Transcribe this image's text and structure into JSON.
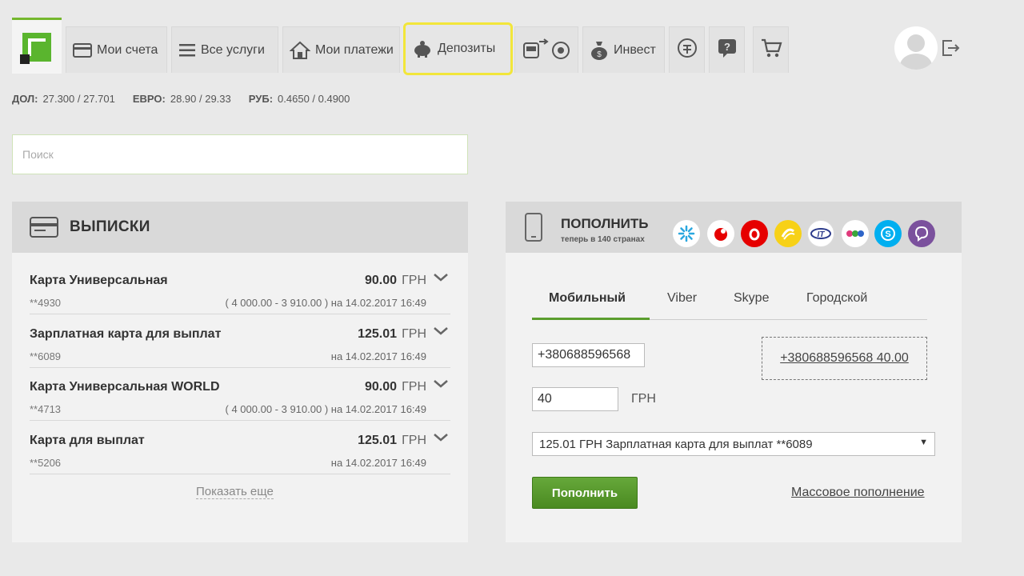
{
  "nav": {
    "tabs": [
      {
        "label": "Мои счета",
        "icon": "card-icon"
      },
      {
        "label": "Все услуги",
        "icon": "list-icon"
      },
      {
        "label": "Мои платежи",
        "icon": "home-icon"
      },
      {
        "label": "Депозиты",
        "icon": "piggy-bank-icon"
      },
      {
        "label": "",
        "icon": "transport-icon"
      },
      {
        "label": "Инвест",
        "icon": "money-bag-icon"
      },
      {
        "label": "",
        "icon": "currency-icon"
      },
      {
        "label": "",
        "icon": "help-icon"
      },
      {
        "label": "",
        "icon": "cart-icon"
      }
    ],
    "highlight_color": "#f2e63a"
  },
  "rates": [
    {
      "label": "ДОЛ:",
      "value": "27.300 / 27.701"
    },
    {
      "label": "ЕВРО:",
      "value": "28.90 / 29.33"
    },
    {
      "label": "РУБ:",
      "value": "0.4650 / 0.4900"
    }
  ],
  "search": {
    "placeholder": "Поиск"
  },
  "statements": {
    "title": "ВЫПИСКИ",
    "rows": [
      {
        "name": "Карта Универсальная",
        "number": "**4930",
        "amount": "90.00",
        "currency": "ГРН",
        "detail": "( 4 000.00 - 3 910.00 ) на 14.02.2017 16:49"
      },
      {
        "name": "Зарплатная карта для выплат",
        "number": "**6089",
        "amount": "125.01",
        "currency": "ГРН",
        "detail": "на 14.02.2017 16:49"
      },
      {
        "name": "Карта Универсальная WORLD",
        "number": "**4713",
        "amount": "90.00",
        "currency": "ГРН",
        "detail": "( 4 000.00 - 3 910.00 ) на 14.02.2017 16:49"
      },
      {
        "name": "Карта для выплат",
        "number": "**5206",
        "amount": "125.01",
        "currency": "ГРН",
        "detail": "на 14.02.2017 16:49"
      }
    ],
    "show_more": "Показать еще"
  },
  "topup": {
    "title": "ПОПОЛНИТЬ",
    "subtitle": "теперь в 140 странах",
    "operators": [
      {
        "icon": "kyivstar-icon",
        "color": "#ffffff"
      },
      {
        "icon": "vodafone-dot-icon",
        "color": "#ffffff"
      },
      {
        "icon": "vodafone-icon",
        "color": "#e60000"
      },
      {
        "icon": "lifecell-icon",
        "color": "#f7d117"
      },
      {
        "icon": "intertelecom-icon",
        "color": "#ffffff"
      },
      {
        "icon": "trimob-icon",
        "color": "#ffffff"
      },
      {
        "icon": "skype-icon",
        "color": "#00aff0"
      },
      {
        "icon": "viber-icon",
        "color": "#7b519d"
      }
    ],
    "tabs": [
      "Мобильный",
      "Viber",
      "Skype",
      "Городской"
    ],
    "phone": "+380688596568",
    "saved_entry": "+380688596568 40.00",
    "amount": "40",
    "currency": "ГРН",
    "source_card": "125.01 ГРН  Зарплатная карта для выплат **6089",
    "submit": "Пополнить",
    "mass_topup": "Массовое пополнение",
    "accent": "#5b9e2e"
  }
}
